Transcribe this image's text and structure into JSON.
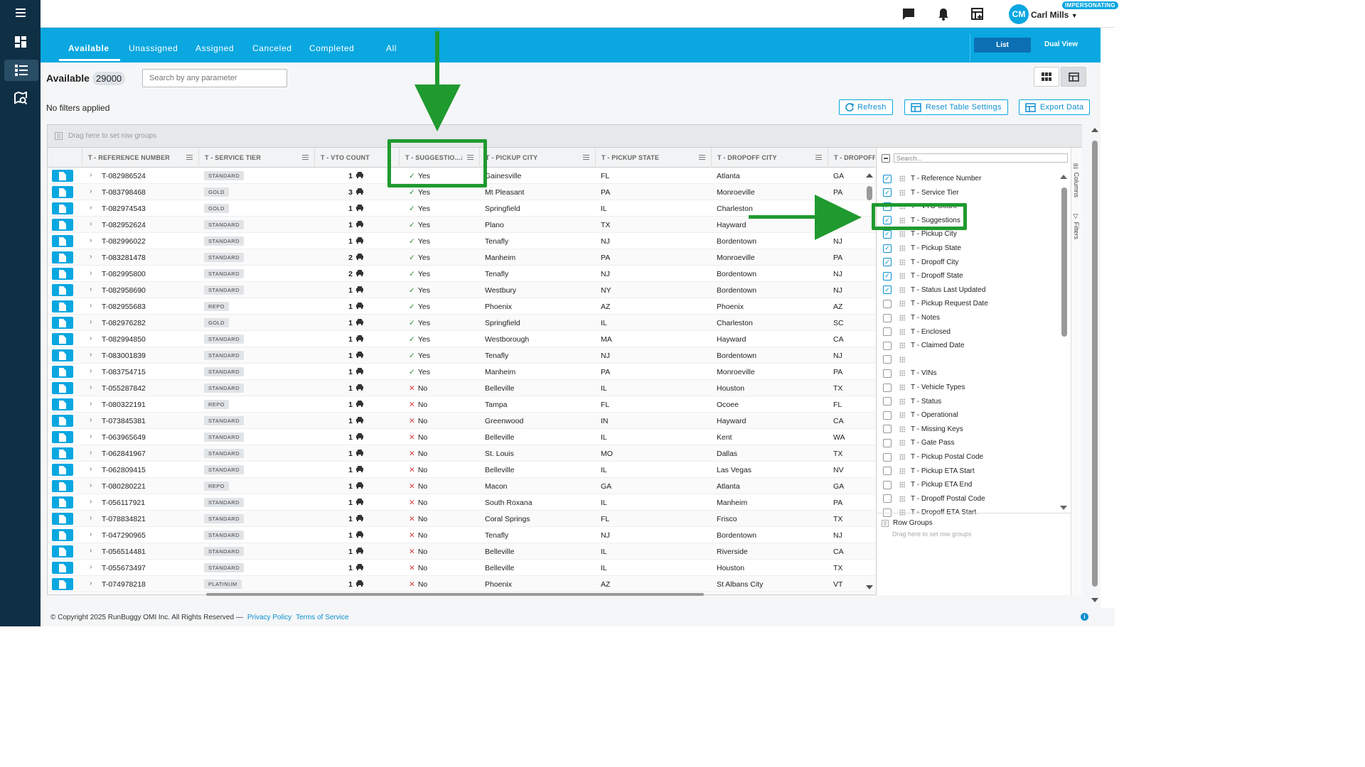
{
  "topbar": {
    "user_name": "Carl Mills",
    "user_initials": "CM",
    "impersonating_label": "IMPERSONATING"
  },
  "tabs": [
    {
      "label": "Available"
    },
    {
      "label": "Unassigned"
    },
    {
      "label": "Assigned"
    },
    {
      "label": "Canceled"
    },
    {
      "label": "Completed"
    },
    {
      "label": "All"
    }
  ],
  "view": {
    "list_label": "List",
    "dual_label": "Dual View"
  },
  "page": {
    "title": "Available",
    "count": "29000",
    "search_placeholder": "Search by any parameter",
    "filters_status": "No filters applied",
    "refresh_label": "Refresh",
    "reset_label": "Reset Table Settings",
    "export_label": "Export Data",
    "group_placeholder": "Drag here to set row groups"
  },
  "columns": [
    "T - REFERENCE NUMBER",
    "T - SERVICE TIER",
    "T - VTO COUNT",
    "T - SUGGESTIO...",
    "T - PICKUP CITY",
    "T - PICKUP STATE",
    "T - DROPOFF CITY",
    "T - DROPOFF S"
  ],
  "rows": [
    {
      "ref": "T-082986524",
      "tier": "STANDARD",
      "vto": "1",
      "sugg": "Yes",
      "pcity": "Gainesville",
      "pstate": "FL",
      "dcity": "Atlanta",
      "dstate": "GA"
    },
    {
      "ref": "T-083798468",
      "tier": "GOLD",
      "vto": "3",
      "sugg": "Yes",
      "pcity": "Mt Pleasant",
      "pstate": "PA",
      "dcity": "Monroeville",
      "dstate": "PA"
    },
    {
      "ref": "T-082974543",
      "tier": "GOLD",
      "vto": "1",
      "sugg": "Yes",
      "pcity": "Springfield",
      "pstate": "IL",
      "dcity": "Charleston",
      "dstate": ""
    },
    {
      "ref": "T-082952624",
      "tier": "STANDARD",
      "vto": "1",
      "sugg": "Yes",
      "pcity": "Plano",
      "pstate": "TX",
      "dcity": "Hayward",
      "dstate": ""
    },
    {
      "ref": "T-082996022",
      "tier": "STANDARD",
      "vto": "1",
      "sugg": "Yes",
      "pcity": "Tenafly",
      "pstate": "NJ",
      "dcity": "Bordentown",
      "dstate": "NJ"
    },
    {
      "ref": "T-083281478",
      "tier": "STANDARD",
      "vto": "2",
      "sugg": "Yes",
      "pcity": "Manheim",
      "pstate": "PA",
      "dcity": "Monroeville",
      "dstate": "PA"
    },
    {
      "ref": "T-082995800",
      "tier": "STANDARD",
      "vto": "2",
      "sugg": "Yes",
      "pcity": "Tenafly",
      "pstate": "NJ",
      "dcity": "Bordentown",
      "dstate": "NJ"
    },
    {
      "ref": "T-082958690",
      "tier": "STANDARD",
      "vto": "1",
      "sugg": "Yes",
      "pcity": "Westbury",
      "pstate": "NY",
      "dcity": "Bordentown",
      "dstate": "NJ"
    },
    {
      "ref": "T-082955683",
      "tier": "REPO",
      "vto": "1",
      "sugg": "Yes",
      "pcity": "Phoenix",
      "pstate": "AZ",
      "dcity": "Phoenix",
      "dstate": "AZ"
    },
    {
      "ref": "T-082976282",
      "tier": "GOLD",
      "vto": "1",
      "sugg": "Yes",
      "pcity": "Springfield",
      "pstate": "IL",
      "dcity": "Charleston",
      "dstate": "SC"
    },
    {
      "ref": "T-082994850",
      "tier": "STANDARD",
      "vto": "1",
      "sugg": "Yes",
      "pcity": "Westborough",
      "pstate": "MA",
      "dcity": "Hayward",
      "dstate": "CA"
    },
    {
      "ref": "T-083001839",
      "tier": "STANDARD",
      "vto": "1",
      "sugg": "Yes",
      "pcity": "Tenafly",
      "pstate": "NJ",
      "dcity": "Bordentown",
      "dstate": "NJ"
    },
    {
      "ref": "T-083754715",
      "tier": "STANDARD",
      "vto": "1",
      "sugg": "Yes",
      "pcity": "Manheim",
      "pstate": "PA",
      "dcity": "Monroeville",
      "dstate": "PA"
    },
    {
      "ref": "T-055287842",
      "tier": "STANDARD",
      "vto": "1",
      "sugg": "No",
      "pcity": "Belleville",
      "pstate": "IL",
      "dcity": "Houston",
      "dstate": "TX"
    },
    {
      "ref": "T-080322191",
      "tier": "REPO",
      "vto": "1",
      "sugg": "No",
      "pcity": "Tampa",
      "pstate": "FL",
      "dcity": "Ocoee",
      "dstate": "FL"
    },
    {
      "ref": "T-073845381",
      "tier": "STANDARD",
      "vto": "1",
      "sugg": "No",
      "pcity": "Greenwood",
      "pstate": "IN",
      "dcity": "Hayward",
      "dstate": "CA"
    },
    {
      "ref": "T-063965649",
      "tier": "STANDARD",
      "vto": "1",
      "sugg": "No",
      "pcity": "Belleville",
      "pstate": "IL",
      "dcity": "Kent",
      "dstate": "WA"
    },
    {
      "ref": "T-062841967",
      "tier": "STANDARD",
      "vto": "1",
      "sugg": "No",
      "pcity": "St. Louis",
      "pstate": "MO",
      "dcity": "Dallas",
      "dstate": "TX"
    },
    {
      "ref": "T-062809415",
      "tier": "STANDARD",
      "vto": "1",
      "sugg": "No",
      "pcity": "Belleville",
      "pstate": "IL",
      "dcity": "Las Vegas",
      "dstate": "NV"
    },
    {
      "ref": "T-080280221",
      "tier": "REPO",
      "vto": "1",
      "sugg": "No",
      "pcity": "Macon",
      "pstate": "GA",
      "dcity": "Atlanta",
      "dstate": "GA"
    },
    {
      "ref": "T-056117921",
      "tier": "STANDARD",
      "vto": "1",
      "sugg": "No",
      "pcity": "South Roxana",
      "pstate": "IL",
      "dcity": "Manheim",
      "dstate": "PA"
    },
    {
      "ref": "T-078834821",
      "tier": "STANDARD",
      "vto": "1",
      "sugg": "No",
      "pcity": "Coral Springs",
      "pstate": "FL",
      "dcity": "Frisco",
      "dstate": "TX"
    },
    {
      "ref": "T-047290965",
      "tier": "STANDARD",
      "vto": "1",
      "sugg": "No",
      "pcity": "Tenafly",
      "pstate": "NJ",
      "dcity": "Bordentown",
      "dstate": "NJ"
    },
    {
      "ref": "T-056514481",
      "tier": "STANDARD",
      "vto": "1",
      "sugg": "No",
      "pcity": "Belleville",
      "pstate": "IL",
      "dcity": "Riverside",
      "dstate": "CA"
    },
    {
      "ref": "T-055673497",
      "tier": "STANDARD",
      "vto": "1",
      "sugg": "No",
      "pcity": "Belleville",
      "pstate": "IL",
      "dcity": "Houston",
      "dstate": "TX"
    },
    {
      "ref": "T-074978218",
      "tier": "PLATINUM",
      "vto": "1",
      "sugg": "No",
      "pcity": "Phoenix",
      "pstate": "AZ",
      "dcity": "St Albans City",
      "dstate": "VT"
    }
  ],
  "panel": {
    "search_placeholder": "Search...",
    "items": [
      {
        "label": "T - Reference Number",
        "checked": true
      },
      {
        "label": "T - Service Tier",
        "checked": true
      },
      {
        "label": "T - VTO Count",
        "checked": true
      },
      {
        "label": "T - Suggestions",
        "checked": true
      },
      {
        "label": "T - Pickup City",
        "checked": true
      },
      {
        "label": "T - Pickup State",
        "checked": true
      },
      {
        "label": "T - Dropoff City",
        "checked": true
      },
      {
        "label": "T - Dropoff State",
        "checked": true
      },
      {
        "label": "T - Status Last Updated",
        "checked": true
      },
      {
        "label": "T - Pickup Request Date",
        "checked": false
      },
      {
        "label": "T - Notes",
        "checked": false
      },
      {
        "label": "T - Enclosed",
        "checked": false
      },
      {
        "label": "T - Claimed Date",
        "checked": false
      },
      {
        "label": "",
        "checked": false
      },
      {
        "label": "T - VINs",
        "checked": false
      },
      {
        "label": "T - Vehicle Types",
        "checked": false
      },
      {
        "label": "T - Status",
        "checked": false
      },
      {
        "label": "T - Operational",
        "checked": false
      },
      {
        "label": "T - Missing Keys",
        "checked": false
      },
      {
        "label": "T - Gate Pass",
        "checked": false
      },
      {
        "label": "T - Pickup Postal Code",
        "checked": false
      },
      {
        "label": "T - Pickup ETA Start",
        "checked": false
      },
      {
        "label": "T - Pickup ETA End",
        "checked": false
      },
      {
        "label": "T - Dropoff Postal Code",
        "checked": false
      },
      {
        "label": "T - Dropoff ETA Start",
        "checked": false
      }
    ],
    "row_groups_label": "Row Groups",
    "row_groups_hint": "Drag here to set row groups",
    "tab_columns": "Columns",
    "tab_filters": "Filters"
  },
  "footer": {
    "copyright": "© Copyright 2025 RunBuggy OMI Inc. All Rights Reserved —",
    "privacy": "Privacy Policy",
    "terms": "Terms of Service"
  },
  "colors": {
    "accent": "#0aa7e1",
    "sidebar": "#0f2f45",
    "annotation": "#1f9a2f"
  }
}
